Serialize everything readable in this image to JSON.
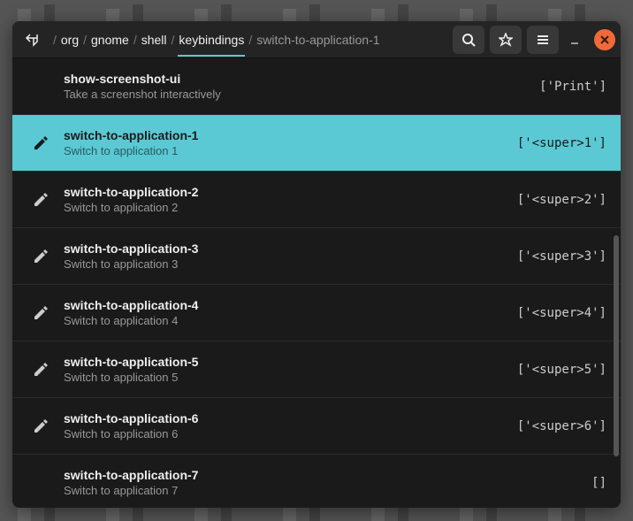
{
  "breadcrumb": {
    "items": [
      "org",
      "gnome",
      "shell",
      "keybindings",
      "switch-to-application-1"
    ],
    "activeIndex": 3
  },
  "rows": [
    {
      "hasIcon": false,
      "title": "show-screenshot-ui",
      "desc": "Take a screenshot interactively",
      "value": "['Print']",
      "selected": false
    },
    {
      "hasIcon": true,
      "title": "switch-to-application-1",
      "desc": "Switch to application 1",
      "value": "['<super>1']",
      "selected": true
    },
    {
      "hasIcon": true,
      "title": "switch-to-application-2",
      "desc": "Switch to application 2",
      "value": "['<super>2']",
      "selected": false
    },
    {
      "hasIcon": true,
      "title": "switch-to-application-3",
      "desc": "Switch to application 3",
      "value": "['<super>3']",
      "selected": false
    },
    {
      "hasIcon": true,
      "title": "switch-to-application-4",
      "desc": "Switch to application 4",
      "value": "['<super>4']",
      "selected": false
    },
    {
      "hasIcon": true,
      "title": "switch-to-application-5",
      "desc": "Switch to application 5",
      "value": "['<super>5']",
      "selected": false
    },
    {
      "hasIcon": true,
      "title": "switch-to-application-6",
      "desc": "Switch to application 6",
      "value": "['<super>6']",
      "selected": false
    },
    {
      "hasIcon": false,
      "title": "switch-to-application-7",
      "desc": "Switch to application 7",
      "value": "[]",
      "selected": false
    }
  ]
}
